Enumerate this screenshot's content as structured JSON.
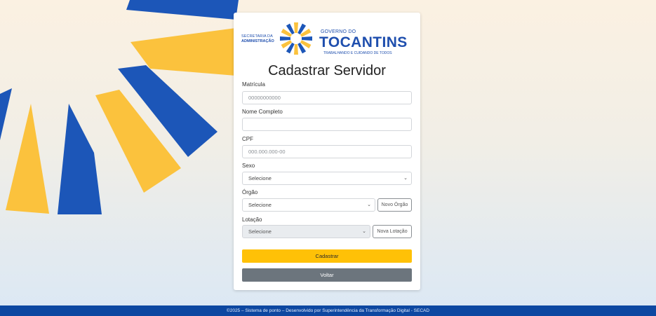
{
  "logo": {
    "secretaria_line1": "SECRETARIA DA",
    "secretaria_line2": "ADMINISTRAÇÃO",
    "governo": "GOVERNO DO",
    "tocantins": "TOCANTINS",
    "slogan": "TRABALHANDO E CUIDANDO DE TODOS"
  },
  "form": {
    "title": "Cadastrar Servidor",
    "matricula": {
      "label": "Matrícula",
      "placeholder": "00000000000",
      "value": ""
    },
    "nome": {
      "label": "Nome Completo",
      "placeholder": "",
      "value": ""
    },
    "cpf": {
      "label": "CPF",
      "placeholder": "000.000.000-00",
      "value": ""
    },
    "sexo": {
      "label": "Sexo",
      "selected": "Selecione"
    },
    "orgao": {
      "label": "Órgão",
      "selected": "Selecione",
      "new_button": "Novo Órgão"
    },
    "lotacao": {
      "label": "Lotação",
      "selected": "Selecione",
      "new_button": "Nova Lotação"
    },
    "submit_label": "Cadastrar",
    "back_label": "Voltar"
  },
  "footer": {
    "text": "©2025 – Sistema de ponto – Desenvolvido por Superintendência da Transformação Digital - SECAD"
  },
  "colors": {
    "brand_blue": "#1f4fae",
    "accent_yellow": "#ffc107",
    "footer_blue": "#0d47a1",
    "secondary_gray": "#6c757d"
  },
  "icons": {
    "select_arrow": "chevron-down-icon",
    "logo_symbol": "sunburst-logo-icon"
  }
}
